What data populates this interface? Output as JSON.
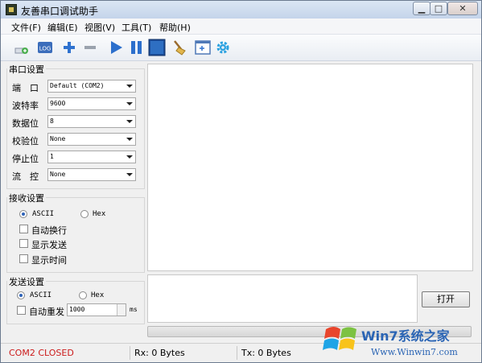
{
  "window": {
    "title": "友善串口调试助手"
  },
  "menu": [
    "文件(F)",
    "编辑(E)",
    "视图(V)",
    "工具(T)",
    "帮助(H)"
  ],
  "toolbar": {
    "icons": [
      "new-session-icon",
      "log-icon",
      "add-icon",
      "remove-icon",
      "play-icon",
      "pause-icon",
      "stop-icon",
      "clear-broom-icon",
      "new-window-icon",
      "settings-gear-icon"
    ],
    "log_text": "LOG"
  },
  "serial": {
    "title": "串口设置",
    "port_label": "端　口",
    "port_value": "Default (COM2)",
    "baud_label": "波特率",
    "baud_value": "9600",
    "data_label": "数据位",
    "data_value": "8",
    "parity_label": "校验位",
    "parity_value": "None",
    "stop_label": "停止位",
    "stop_value": "1",
    "flow_label": "流　控",
    "flow_value": "None"
  },
  "receive": {
    "title": "接收设置",
    "ascii": "ASCII",
    "hex": "Hex",
    "selected": "ASCII",
    "auto_wrap": "自动换行",
    "show_send": "显示发送",
    "show_time": "显示时间"
  },
  "send": {
    "title": "发送设置",
    "ascii": "ASCII",
    "hex": "Hex",
    "selected": "ASCII",
    "auto_resend": "自动重发",
    "interval": "1000",
    "unit": "ms"
  },
  "open_button": "打开",
  "status": {
    "port": "COM2 CLOSED",
    "rx": "Rx: 0 Bytes",
    "tx": "Tx: 0 Bytes"
  },
  "colors": {
    "status_closed": "#cc1b1b",
    "accent": "#2e6fc2"
  },
  "watermark": {
    "brand": "Win7系统之家",
    "url": "Www.Winwin7.com"
  }
}
